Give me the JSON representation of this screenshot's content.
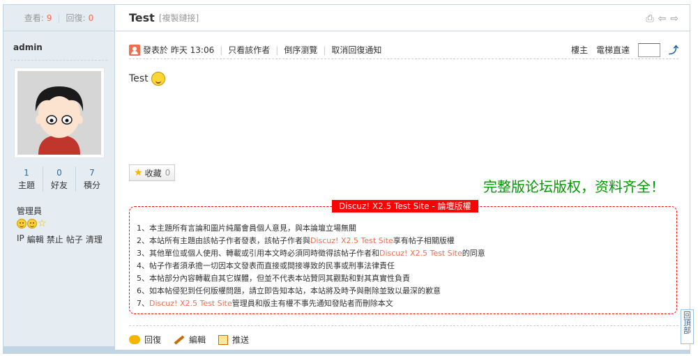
{
  "stats": {
    "views_label": "查看:",
    "views": "9",
    "replies_label": "回復:",
    "replies": "0"
  },
  "thread": {
    "title": "Test",
    "copy_link": "[複製鏈接]"
  },
  "author": {
    "name": "admin",
    "counts": [
      {
        "value": "1",
        "label": "主題"
      },
      {
        "value": "0",
        "label": "好友"
      },
      {
        "value": "7",
        "label": "積分"
      }
    ],
    "group": "管理員",
    "admin_links": [
      "IP",
      "編輯",
      "禁止",
      "帖子",
      "清理"
    ]
  },
  "post_info": {
    "posted": "發表於 昨天 13:06",
    "only_author": "只看該作者",
    "reverse": "倒序瀏覽",
    "cancel_notify": "取消回復通知",
    "floor": "樓主",
    "jump_label": "電梯直達"
  },
  "post": {
    "content": "Test"
  },
  "favorite": {
    "label": "收藏",
    "count": "0"
  },
  "promo": "完整版论坛版权，资料齐全！",
  "copyright": {
    "title": "Discuz! X2.5 Test Site - 論壇版權",
    "site": "Discuz! X2.5 Test Site",
    "lines": [
      {
        "pre": "1、本主題所有言論和圖片純屬會員個人意見，與本論壇立場無關",
        "hl": "",
        "post": ""
      },
      {
        "pre": "2、本站所有主題由該帖子作者發表，該帖子作者與",
        "hl": "Discuz! X2.5 Test Site",
        "post": "享有帖子相關版權"
      },
      {
        "pre": "3、其他單位或個人使用、轉載或引用本文時必須同時徵得該帖子作者和",
        "hl": "Discuz! X2.5 Test Site",
        "post": "的同意"
      },
      {
        "pre": "4、帖子作者須承擔一切因本文發表而直接或間接導致的民事或刑事法律責任",
        "hl": "",
        "post": ""
      },
      {
        "pre": "5、本帖部分內容轉載自其它媒體，但並不代表本站贊同其觀點和對其真實性負責",
        "hl": "",
        "post": ""
      },
      {
        "pre": "6、如本帖侵犯到任何版權問題，請立即告知本站，本站將及時予與刪除並致以最深的歉意",
        "hl": "",
        "post": ""
      },
      {
        "pre": "7、",
        "hl": "Discuz! X2.5 Test Site",
        "post": "管理員和版主有權不事先通知發貼者而刪除本文"
      }
    ]
  },
  "actions": {
    "reply": "回復",
    "edit": "編輯",
    "push": "推送"
  },
  "back_top": "回頂部"
}
